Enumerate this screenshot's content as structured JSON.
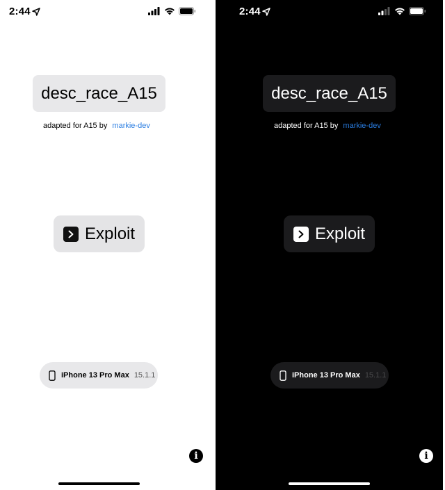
{
  "status_bar": {
    "time": "2:44",
    "location_icon": "location-arrow-icon",
    "signal_icon": "cellular-signal-icon",
    "wifi_icon": "wifi-icon",
    "battery_icon": "battery-icon"
  },
  "app": {
    "title": "desc_race_A15",
    "credit_prefix": "adapted for A15 by",
    "credit_author": "markie-dev",
    "exploit_label": "Exploit",
    "exploit_icon": "chevron-right-square-icon",
    "device_model": "iPhone 13 Pro Max",
    "ios_version": "15.1.1",
    "device_icon": "iphone-icon",
    "info_icon": "info-circle-icon",
    "info_glyph": "i"
  },
  "colors": {
    "light_background": "#ffffff",
    "dark_background": "#000000",
    "link": "#2a7de1",
    "light_card": "#e8e8ea",
    "dark_card": "#1b1b1d"
  }
}
